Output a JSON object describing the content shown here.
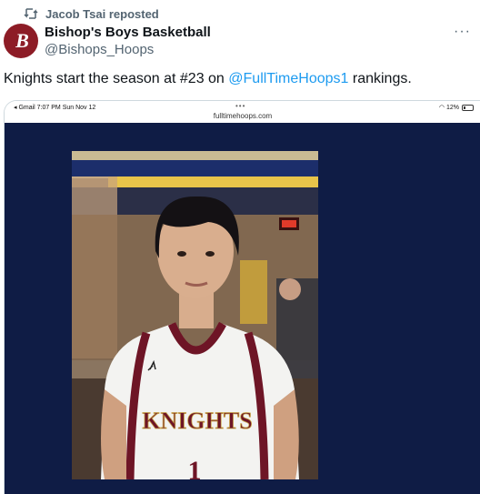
{
  "repost": {
    "icon": "repost-icon",
    "text": "Jacob Tsai reposted"
  },
  "author": {
    "avatar_icon": "bishops-logo-avatar",
    "avatar_monogram": "B",
    "name": "Bishop's Boys Basketball",
    "handle": "@Bishops_Hoops",
    "more_icon": "more-options-icon",
    "more_glyph": "···"
  },
  "tweet": {
    "text_before": "Knights start the season at #23 on ",
    "mention": "@FullTimeHoops1",
    "text_after": " rankings."
  },
  "media": {
    "status": {
      "left": "◂ Gmail   7:07 PM   Sun Nov 12",
      "dots": "•••",
      "url": "fulltimehoops.com",
      "battery": "12%"
    },
    "photo": {
      "jersey_text": "KNIGHTS",
      "jersey_number": "1"
    }
  },
  "colors": {
    "link": "#1d9bf0",
    "secondary_text": "#536471",
    "navy_background": "#0f1c45",
    "maroon": "#6e1526"
  }
}
